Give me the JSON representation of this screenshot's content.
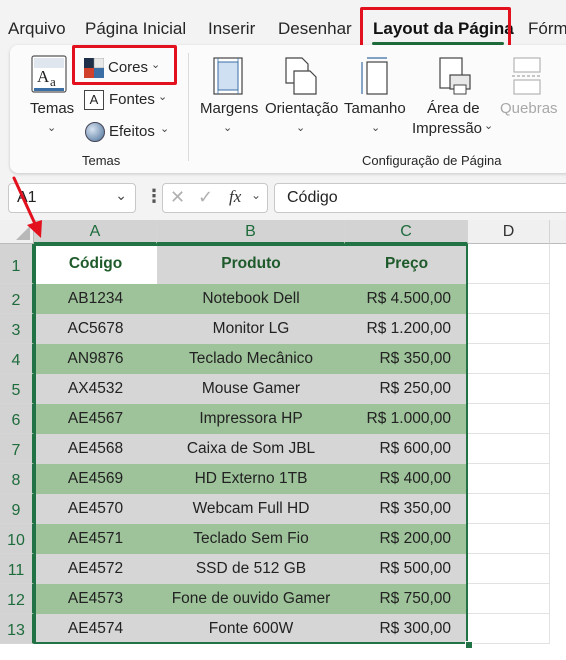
{
  "tabs": [
    {
      "label": "Arquivo"
    },
    {
      "label": "Página Inicial"
    },
    {
      "label": "Inserir"
    },
    {
      "label": "Desenhar"
    },
    {
      "label": "Layout da Página"
    },
    {
      "label": "Fórm"
    }
  ],
  "ribbon": {
    "temas_group": {
      "temas_label": "Temas",
      "cores_label": "Cores",
      "fontes_label": "Fontes",
      "efeitos_label": "Efeitos",
      "group_label": "Temas"
    },
    "config_group": {
      "margens_label": "Margens",
      "orientacao_label": "Orientação",
      "tamanho_label": "Tamanho",
      "area_line1": "Área de",
      "area_line2": "Impressão",
      "quebras_label": "Quebras",
      "group_label": "Configuração de Página"
    }
  },
  "formula_bar": {
    "name_box": "A1",
    "formula": "Código",
    "fx": "fx"
  },
  "sheet": {
    "columns": [
      "A",
      "B",
      "C",
      "D"
    ],
    "rows": [
      "1",
      "2",
      "3",
      "4",
      "5",
      "6",
      "7",
      "8",
      "9",
      "10",
      "11",
      "12",
      "13"
    ],
    "headers": [
      "Código",
      "Produto",
      "Preço"
    ],
    "data": [
      [
        "AB1234",
        "Notebook Dell",
        "R$ 4.500,00"
      ],
      [
        "AC5678",
        "Monitor LG",
        "R$ 1.200,00"
      ],
      [
        "AN9876",
        "Teclado Mecânico",
        "R$ 350,00"
      ],
      [
        "AX4532",
        "Mouse Gamer",
        "R$ 250,00"
      ],
      [
        "AE4567",
        "Impressora HP",
        "R$ 1.000,00"
      ],
      [
        "AE4568",
        "Caixa de Som JBL",
        "R$ 600,00"
      ],
      [
        "AE4569",
        "HD Externo 1TB",
        "R$ 400,00"
      ],
      [
        "AE4570",
        "Webcam Full HD",
        "R$ 350,00"
      ],
      [
        "AE4571",
        "Teclado Sem Fio",
        "R$ 200,00"
      ],
      [
        "AE4572",
        "SSD de 512 GB",
        "R$ 500,00"
      ],
      [
        "AE4573",
        "Fone de ouvido Gamer",
        "R$ 750,00"
      ],
      [
        "AE4574",
        "Fonte 600W",
        "R$ 300,00"
      ]
    ]
  },
  "colors": {
    "accent": "#1e6b3c",
    "highlight_box": "#e3101e",
    "row_green": "#9ec39a",
    "row_gray": "#d6d6d6",
    "selection_border": "#217346"
  }
}
